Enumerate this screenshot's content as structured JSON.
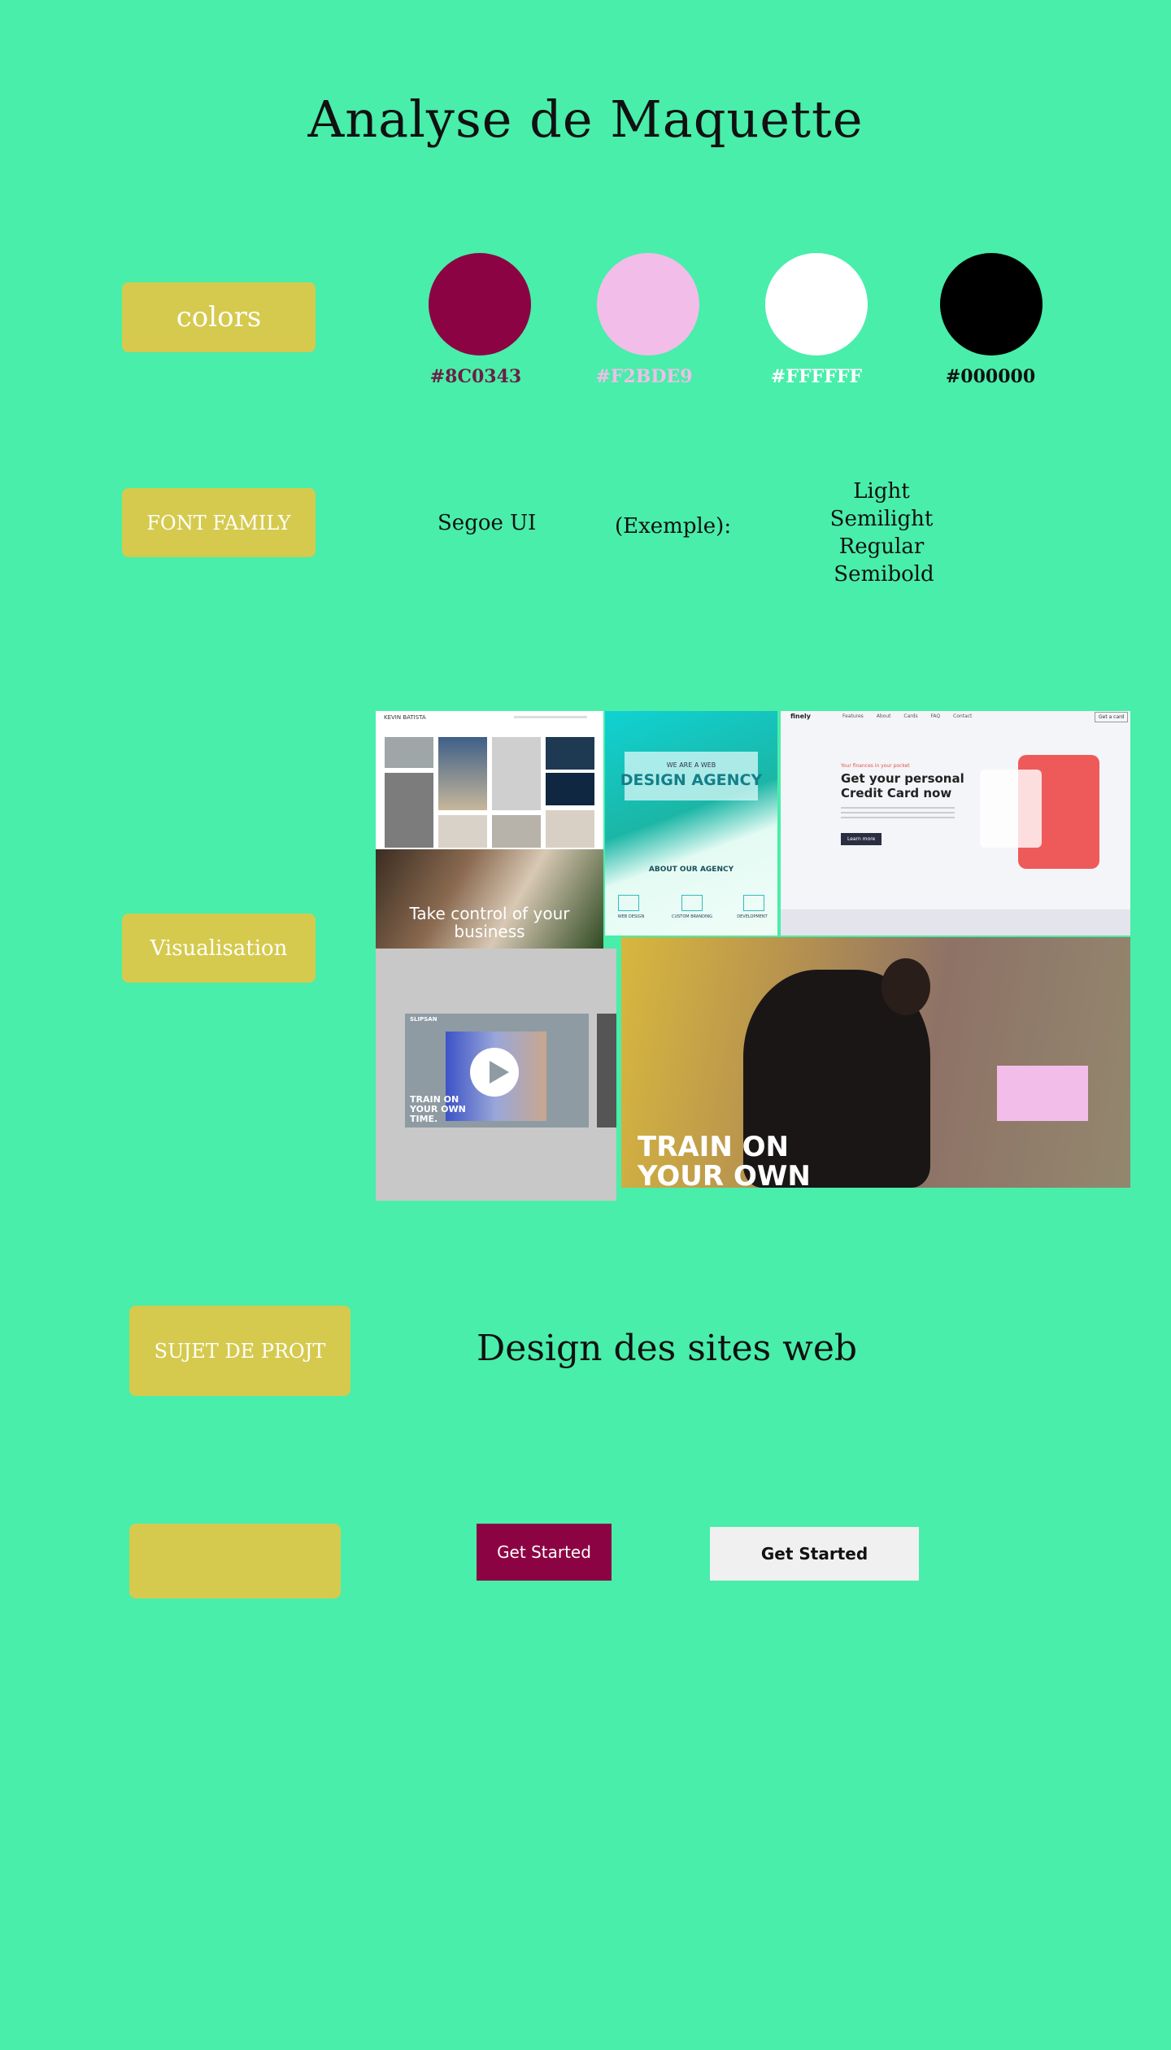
{
  "title": "Analyse de Maquette",
  "labels": {
    "colors": "colors",
    "font_family": "FONT FAMILY",
    "visualisation": "Visualisation",
    "sujet": "SUJET DE PROJT",
    "empty": ""
  },
  "colors": [
    {
      "hex_label": "#8C0343",
      "value": "#8C0343"
    },
    {
      "hex_label": "#F2BDE9",
      "value": "#F2BDE9"
    },
    {
      "hex_label": "#FFFFFF",
      "value": "#FFFFFF"
    },
    {
      "hex_label": "#000000",
      "value": "#000000"
    }
  ],
  "font": {
    "name": "Segoe UI",
    "example": "(Exemple):",
    "weights": [
      "Light",
      "Semilight",
      "Regular",
      "Semibold"
    ]
  },
  "visualisation": {
    "portfolio_name": "KEVIN BATISTA",
    "portfolio_caption": "Take control of your business",
    "agency_title": "WE ARE A WEB",
    "agency_heading": "DESIGN AGENCY",
    "agency_about": "ABOUT OUR AGENCY",
    "agency_services": [
      "WEB DESIGN",
      "CUSTOM BRANDING",
      "DEVELOPMENT"
    ],
    "finely_brand": "finely",
    "finely_nav": [
      "Features",
      "About",
      "Cards",
      "FAQ",
      "Contact"
    ],
    "finely_cta": "Get a card",
    "finely_small": "Your finances in your pocket",
    "finely_heading": "Get your personal Credit Card now",
    "finely_button": "Learn more",
    "fitness_brand": "SLIPSAN",
    "fitness_caption": "TRAIN ON YOUR OWN TIME.",
    "train_caption": "TRAIN ON YOUR OWN TIME"
  },
  "sujet": "Design des sites web",
  "buttons": {
    "primary": "Get Started",
    "secondary": "Get Started"
  },
  "accent": {
    "background": "#48EEAA",
    "label_box": "#D5CA4E"
  }
}
